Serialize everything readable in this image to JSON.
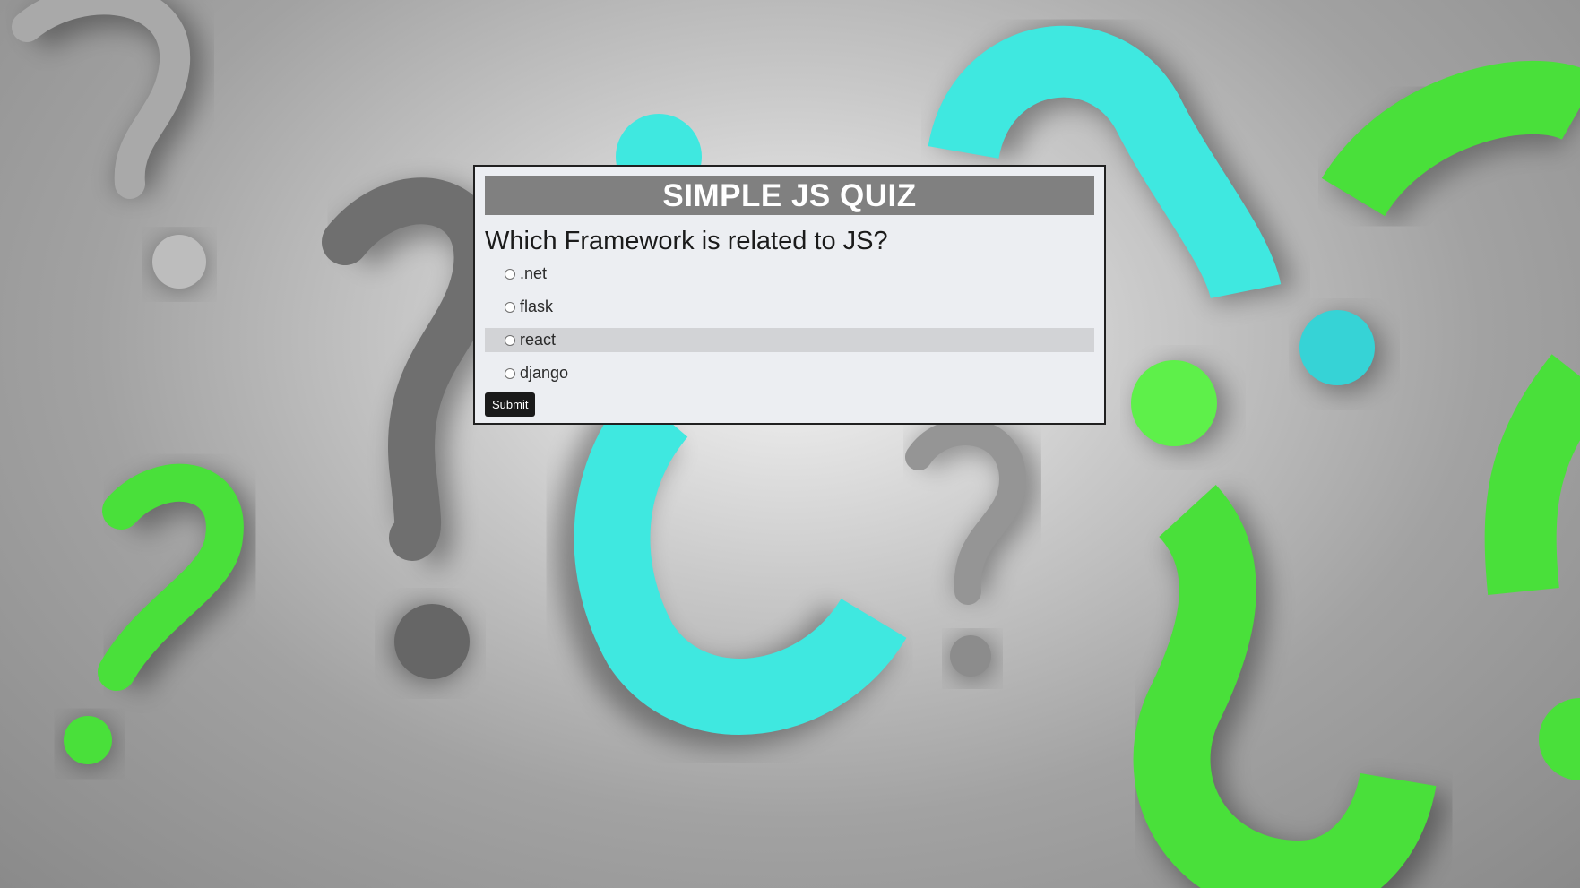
{
  "quiz": {
    "title": "SIMPLE JS QUIZ",
    "question": "Which Framework is related to JS?",
    "answers": [
      ".net",
      "flask",
      "react",
      "django"
    ],
    "highlighted_answer": "react",
    "submit_label": "Submit"
  },
  "colors": {
    "header_bg": "#808080",
    "card_bg": "#eceef2",
    "card_border": "#202020",
    "hover_row": "#d2d3d6",
    "button_bg": "#1a1a1a",
    "accent_cyan": "#3fe8e0",
    "accent_green": "#49e03a",
    "accent_gray": "#9a9a9a"
  },
  "background": {
    "theme": "question-marks-background"
  }
}
